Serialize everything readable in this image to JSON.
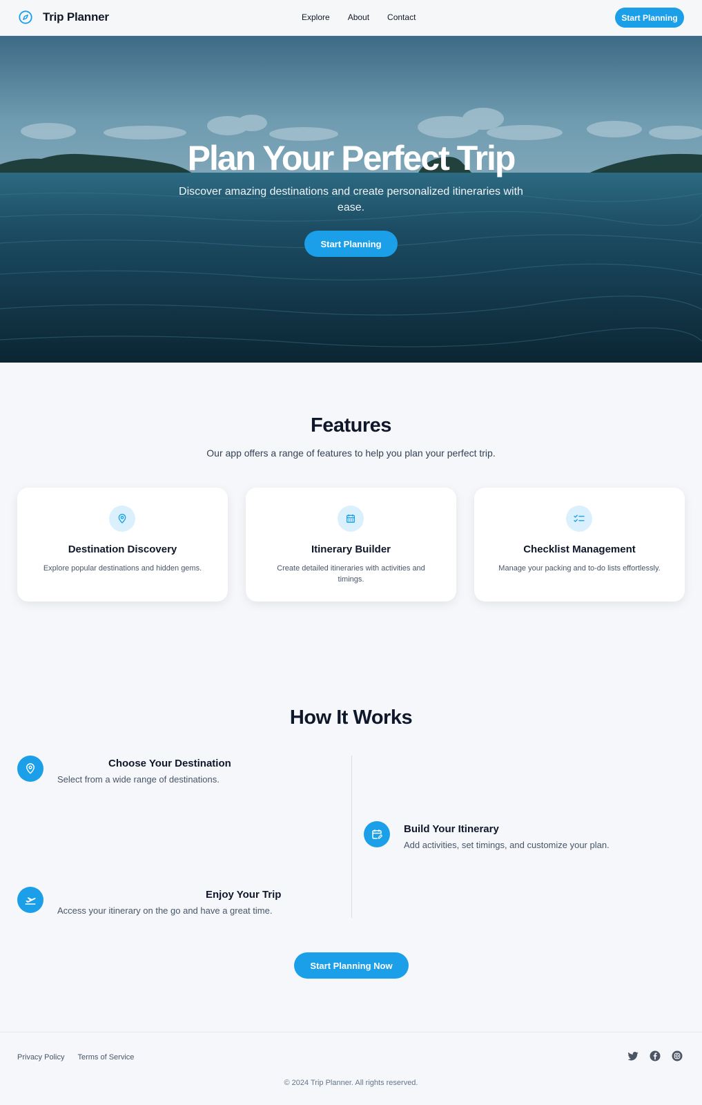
{
  "header": {
    "brand": "Trip Planner",
    "nav": [
      "Explore",
      "About",
      "Contact"
    ],
    "cta_label": "Start Planning"
  },
  "hero": {
    "title": "Plan Your Perfect Trip",
    "subtitle": "Discover amazing destinations and create personalized itineraries with ease.",
    "cta_label": "Start Planning"
  },
  "features": {
    "title": "Features",
    "subtitle": "Our app offers a range of features to help you plan your perfect trip.",
    "cards": [
      {
        "icon": "map-pin-icon",
        "title": "Destination Discovery",
        "description": "Explore popular destinations and hidden gems."
      },
      {
        "icon": "calendar-icon",
        "title": "Itinerary Builder",
        "description": "Create detailed itineraries with activities and timings."
      },
      {
        "icon": "checklist-icon",
        "title": "Checklist Management",
        "description": "Manage your packing and to-do lists effortlessly."
      }
    ]
  },
  "how_it_works": {
    "title": "How It Works",
    "steps": [
      {
        "icon": "map-pin-icon",
        "title": "Choose Your Destination",
        "description": "Select from a wide range of destinations."
      },
      {
        "icon": "calendar-edit-icon",
        "title": "Build Your Itinerary",
        "description": "Add activities, set timings, and customize your plan."
      },
      {
        "icon": "plane-departure-icon",
        "title": "Enjoy Your Trip",
        "description": "Access your itinerary on the go and have a great time."
      }
    ],
    "cta_label": "Start Planning Now"
  },
  "footer": {
    "links": [
      "Privacy Policy",
      "Terms of Service"
    ],
    "socials": [
      "twitter-icon",
      "facebook-icon",
      "instagram-icon"
    ],
    "copyright": "© 2024 Trip Planner. All rights reserved."
  },
  "colors": {
    "accent": "#1a9fe8",
    "accent_light": "#daf0fc",
    "background": "#f5f7fa",
    "text": "#0f172a"
  }
}
